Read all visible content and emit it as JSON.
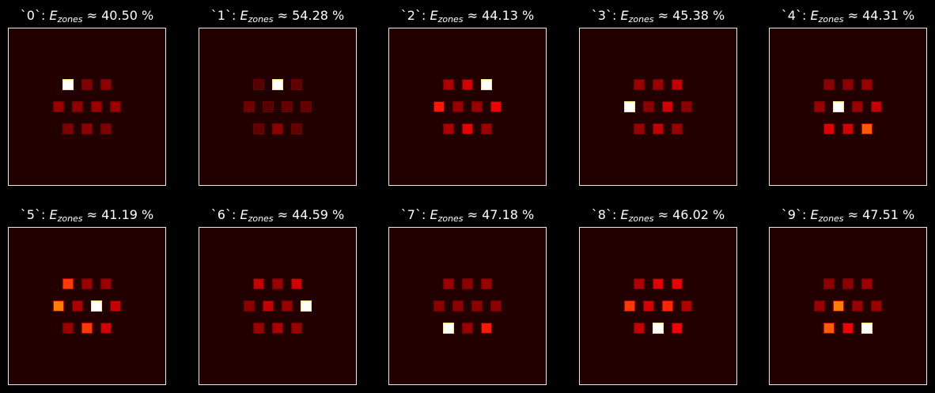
{
  "chart_data": {
    "type": "heatmap",
    "description_note": "",
    "colormap": "hot",
    "background_value": 0.05,
    "zone_grid": [
      [
        "z0",
        "z1",
        "z2"
      ],
      [
        "z3",
        "z4",
        "z5",
        "z6"
      ],
      [
        "z7",
        "z8",
        "z9"
      ]
    ],
    "panels": [
      {
        "label": "`0`",
        "metric": "40.50 %",
        "zones": [
          1.0,
          0.18,
          0.2,
          0.22,
          0.2,
          0.22,
          0.22,
          0.18,
          0.2,
          0.18
        ]
      },
      {
        "label": "`1`",
        "metric": "54.28 %",
        "zones": [
          0.12,
          1.0,
          0.14,
          0.16,
          0.12,
          0.14,
          0.14,
          0.14,
          0.2,
          0.14
        ]
      },
      {
        "label": "`2`",
        "metric": "44.13 %",
        "zones": [
          0.25,
          0.3,
          1.0,
          0.4,
          0.22,
          0.22,
          0.35,
          0.25,
          0.33,
          0.22
        ]
      },
      {
        "label": "`3`",
        "metric": "45.38 %",
        "zones": [
          0.22,
          0.22,
          0.28,
          1.0,
          0.2,
          0.3,
          0.2,
          0.22,
          0.28,
          0.22
        ]
      },
      {
        "label": "`4`",
        "metric": "44.31 %",
        "zones": [
          0.2,
          0.2,
          0.22,
          0.22,
          1.0,
          0.22,
          0.28,
          0.32,
          0.3,
          0.5
        ]
      },
      {
        "label": "`5`",
        "metric": "41.19 %",
        "zones": [
          0.45,
          0.22,
          0.22,
          0.55,
          0.25,
          1.0,
          0.28,
          0.22,
          0.45,
          0.3
        ]
      },
      {
        "label": "`6`",
        "metric": "44.59 %",
        "zones": [
          0.28,
          0.22,
          0.3,
          0.2,
          0.28,
          0.22,
          1.0,
          0.22,
          0.25,
          0.22
        ]
      },
      {
        "label": "`7`",
        "metric": "47.18 %",
        "zones": [
          0.22,
          0.2,
          0.22,
          0.2,
          0.2,
          0.2,
          0.2,
          1.0,
          0.22,
          0.4
        ]
      },
      {
        "label": "`8`",
        "metric": "46.02 %",
        "zones": [
          0.25,
          0.32,
          0.33,
          0.45,
          0.3,
          0.42,
          0.25,
          0.28,
          1.0,
          0.35
        ]
      },
      {
        "label": "`9`",
        "metric": "47.51 %",
        "zones": [
          0.2,
          0.2,
          0.22,
          0.22,
          0.55,
          0.22,
          0.22,
          0.5,
          0.35,
          1.0
        ]
      }
    ]
  }
}
